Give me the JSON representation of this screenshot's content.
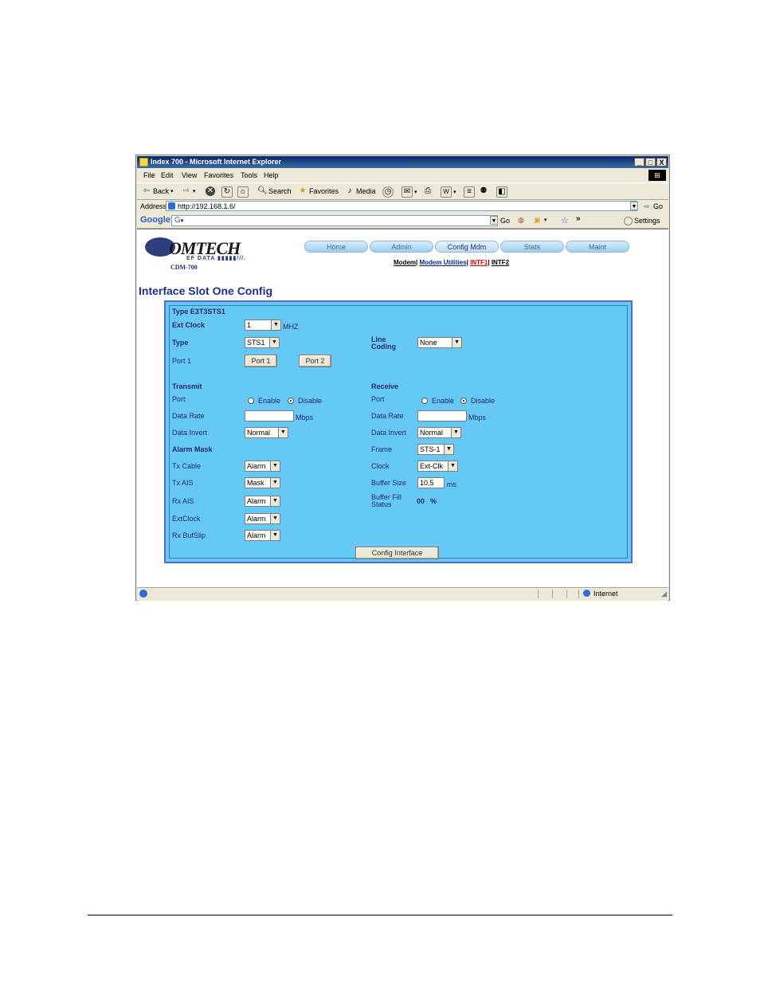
{
  "window": {
    "title": "Index 700 - Microsoft Internet Explorer",
    "controls": [
      "_",
      "□",
      "X"
    ]
  },
  "menu": [
    "File",
    "Edit",
    "View",
    "Favorites",
    "Tools",
    "Help"
  ],
  "toolbar": {
    "back": "Back",
    "search": "Search",
    "favorites": "Favorites",
    "media": "Media"
  },
  "address": {
    "label": "Address",
    "url": "http://192.168.1.6/",
    "go": "Go"
  },
  "google_bar": {
    "logo": "Google",
    "field": "G",
    "go": "Go",
    "more": "»",
    "settings": "Settings"
  },
  "brand": {
    "name": "OMTECH",
    "sub": "EF DATA",
    "model": "CDM-700"
  },
  "nav": {
    "tabs": [
      "Home",
      "Admin",
      "Config Mdm",
      "Stats",
      "Maint"
    ],
    "active": "Config Mdm",
    "sublinks": {
      "modem": "Modem",
      "modem_utilities": "Modem Utilities",
      "intf1": "INTF1",
      "intf2": "INTF2",
      "sep": "|"
    }
  },
  "page": {
    "title": "Interface Slot One Config"
  },
  "form": {
    "type_heading": "Type E3T3STS1",
    "ext_clock": {
      "label": "Ext Clock",
      "value": "1",
      "unit": "MHZ"
    },
    "type": {
      "label": "Type",
      "value": "STS1"
    },
    "line_coding": {
      "label_1": "Line",
      "label_2": "Coding",
      "value": "None"
    },
    "port1": {
      "label": "Port 1",
      "button1": "Port 1",
      "button2": "Port 2"
    },
    "transmit": {
      "heading": "Transmit",
      "port_label": "Port",
      "enable": "Enable",
      "disable": "Disable",
      "selected": "Disable",
      "data_rate_label": "Data Rate",
      "data_rate_value": "",
      "data_rate_unit": "Mbps",
      "data_invert_label": "Data Invert",
      "data_invert_value": "Normal"
    },
    "receive": {
      "heading": "Receive",
      "port_label": "Port",
      "enable": "Enable",
      "disable": "Disable",
      "selected": "Disable",
      "data_rate_label": "Data Rate",
      "data_rate_value": "",
      "data_rate_unit": "Mbps",
      "data_invert_label": "Data Invert",
      "data_invert_value": "Normal",
      "frame_label": "Frame",
      "frame_value": "STS-1",
      "clock_label": "Clock",
      "clock_value": "Ext-Clk",
      "buffer_size_label": "Buffer Size",
      "buffer_size_value": "10.5",
      "buffer_size_unit": "ms",
      "buffer_fill_label_1": "Buffer Fill",
      "buffer_fill_label_2": "Status",
      "buffer_fill_value": "00",
      "buffer_fill_unit": "%"
    },
    "alarm_mask": {
      "heading": "Alarm Mask",
      "tx_cable": {
        "label": "Tx Cable",
        "value": "Alarm"
      },
      "tx_ais": {
        "label": "Tx AIS",
        "value": "Mask"
      },
      "rx_ais": {
        "label": "Rx AIS",
        "value": "Alarm"
      },
      "ext_clock": {
        "label": "ExtClock",
        "value": "Alarm"
      },
      "rx_bufslip": {
        "label": "Rx BufSlip",
        "value": "Alarm"
      }
    },
    "submit": "Config Interface"
  },
  "status_bar": {
    "zone": "Internet"
  },
  "colors": {
    "panel_bg": "#66c9f5",
    "panel_border": "#4a6fd0",
    "label_text": "#1e2a6a",
    "title_text": "#1e2d8a",
    "intf1_link": "#d90000"
  }
}
